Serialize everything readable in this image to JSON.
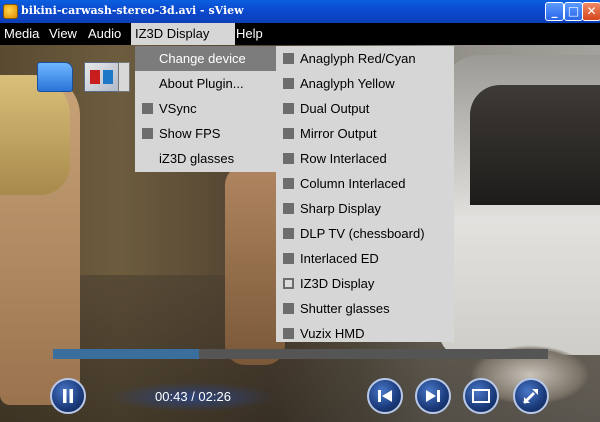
{
  "window": {
    "title": "bikini-carwash-stereo-3d.avi - sView",
    "buttons": {
      "minimize": "_",
      "maximize": "□",
      "close": "✕"
    }
  },
  "menubar": {
    "items": [
      {
        "label": "Media"
      },
      {
        "label": "View"
      },
      {
        "label": "Audio"
      },
      {
        "label": "IZ3D Display",
        "active": true
      },
      {
        "label": "Help"
      }
    ]
  },
  "menu_iz3d": {
    "items": [
      {
        "label": "Change device",
        "highlight": true,
        "checkbox": false
      },
      {
        "label": "About Plugin...",
        "checkbox": false
      },
      {
        "label": "VSync",
        "checkbox": true
      },
      {
        "label": "Show FPS",
        "checkbox": true
      },
      {
        "label": "iZ3D glasses",
        "checkbox": false
      }
    ]
  },
  "submenu_devices": {
    "items": [
      {
        "label": "Anaglyph Red/Cyan",
        "selected": false
      },
      {
        "label": "Anaglyph Yellow",
        "selected": false
      },
      {
        "label": "Dual Output",
        "selected": false
      },
      {
        "label": "Mirror Output",
        "selected": false
      },
      {
        "label": "Row Interlaced",
        "selected": false
      },
      {
        "label": "Column Interlaced",
        "selected": false
      },
      {
        "label": "Sharp Display",
        "selected": false
      },
      {
        "label": "DLP TV (chessboard)",
        "selected": false
      },
      {
        "label": "Interlaced ED",
        "selected": false
      },
      {
        "label": "IZ3D Display",
        "selected": true
      },
      {
        "label": "Shutter glasses",
        "selected": false
      },
      {
        "label": "Vuzix HMD",
        "selected": false
      }
    ]
  },
  "playback": {
    "time": "00:43 / 02:26",
    "progress_fraction": 0.294
  },
  "toolbar": {
    "icons": [
      "open-folder-icon",
      "stereo-mode-icon"
    ]
  },
  "controls": [
    "pause-icon",
    "previous-icon",
    "next-icon",
    "fullscreen-icon",
    "swap-lr-icon"
  ],
  "colors": {
    "titlebar": "#0b4bd0",
    "menu_bg": "#d6d6d6",
    "menu_highlight": "#7c7c7c",
    "progress_fill": "#3a6e9c"
  }
}
